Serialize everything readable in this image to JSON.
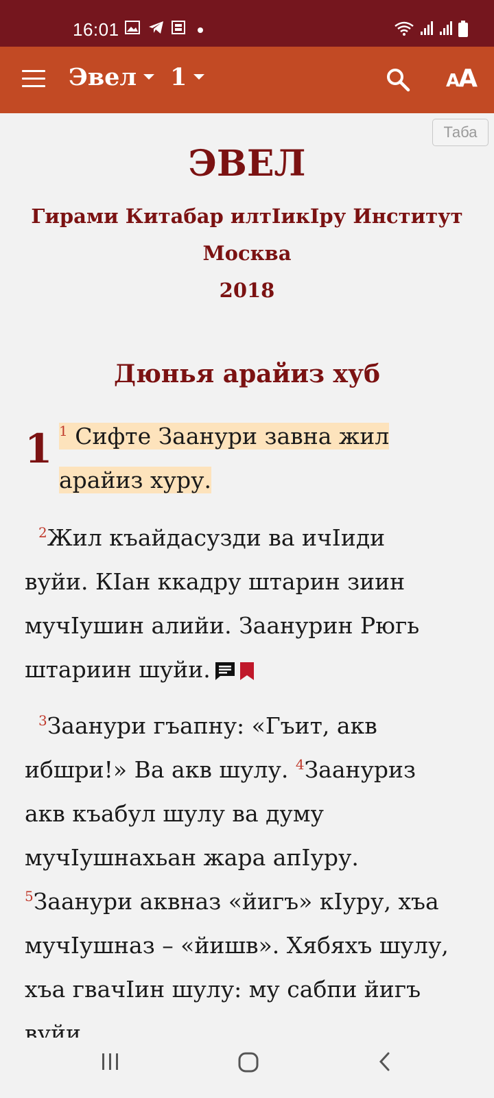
{
  "status_bar": {
    "time": "16:01"
  },
  "app_bar": {
    "book": "Эвел",
    "chapter": "1"
  },
  "tab_chip": "Таба",
  "intro": {
    "title": "ЭВЕЛ",
    "line1": "Гирами Китабар илтІикІру Институт",
    "line2": "Москва",
    "line3": "2018"
  },
  "section_heading": "Дюнья арайиз хуб",
  "chapter_number": "1",
  "verses": {
    "v1_num": "1",
    "v1_line1": "Сифте Заанури завна жил",
    "v1_line2": "арайиз хуру.",
    "v2_num": "2",
    "v2_line1": "Жил къайдасузди ва ичІиди",
    "v2_line2": "вуйи. КІан ккадру штарин зиин",
    "v2_line3": "мучІушин алийи. Заанурин Рюгь",
    "v2_line4": "штариин шуйи.",
    "v3_num": "3",
    "v3_line1": "Заанури гъапну: «Гъит, акв",
    "v3_line2a": "ибшри!» Ва акв шулу.",
    "v4_num": "4",
    "v4_line2b": "Заануриз",
    "v4_line3": "акв къабул шулу ва думу",
    "v4_line4": "мучІушнахьан жара апІуру.",
    "v5_num": "5",
    "v5_line1": "Заанури аквназ «йигъ» кІуру, хъа",
    "v5_line2": "мучІушназ – «йишв». Хябяхъ шулу,",
    "v5_line3": "хъа гвачІин шулу: му сабпи йигъ",
    "v5_line4": "вуйи."
  },
  "icons": {
    "menu": "menu-icon",
    "search": "search-icon",
    "text_size": "text-size-icon",
    "note": "note-icon",
    "bookmark": "bookmark-icon"
  },
  "colors": {
    "status_bar": "#75161e",
    "app_bar": "#c24a24",
    "heading": "#7b1212",
    "verse_number": "#c0392b",
    "highlight": "#fde3bc",
    "bookmark": "#c0182a"
  }
}
